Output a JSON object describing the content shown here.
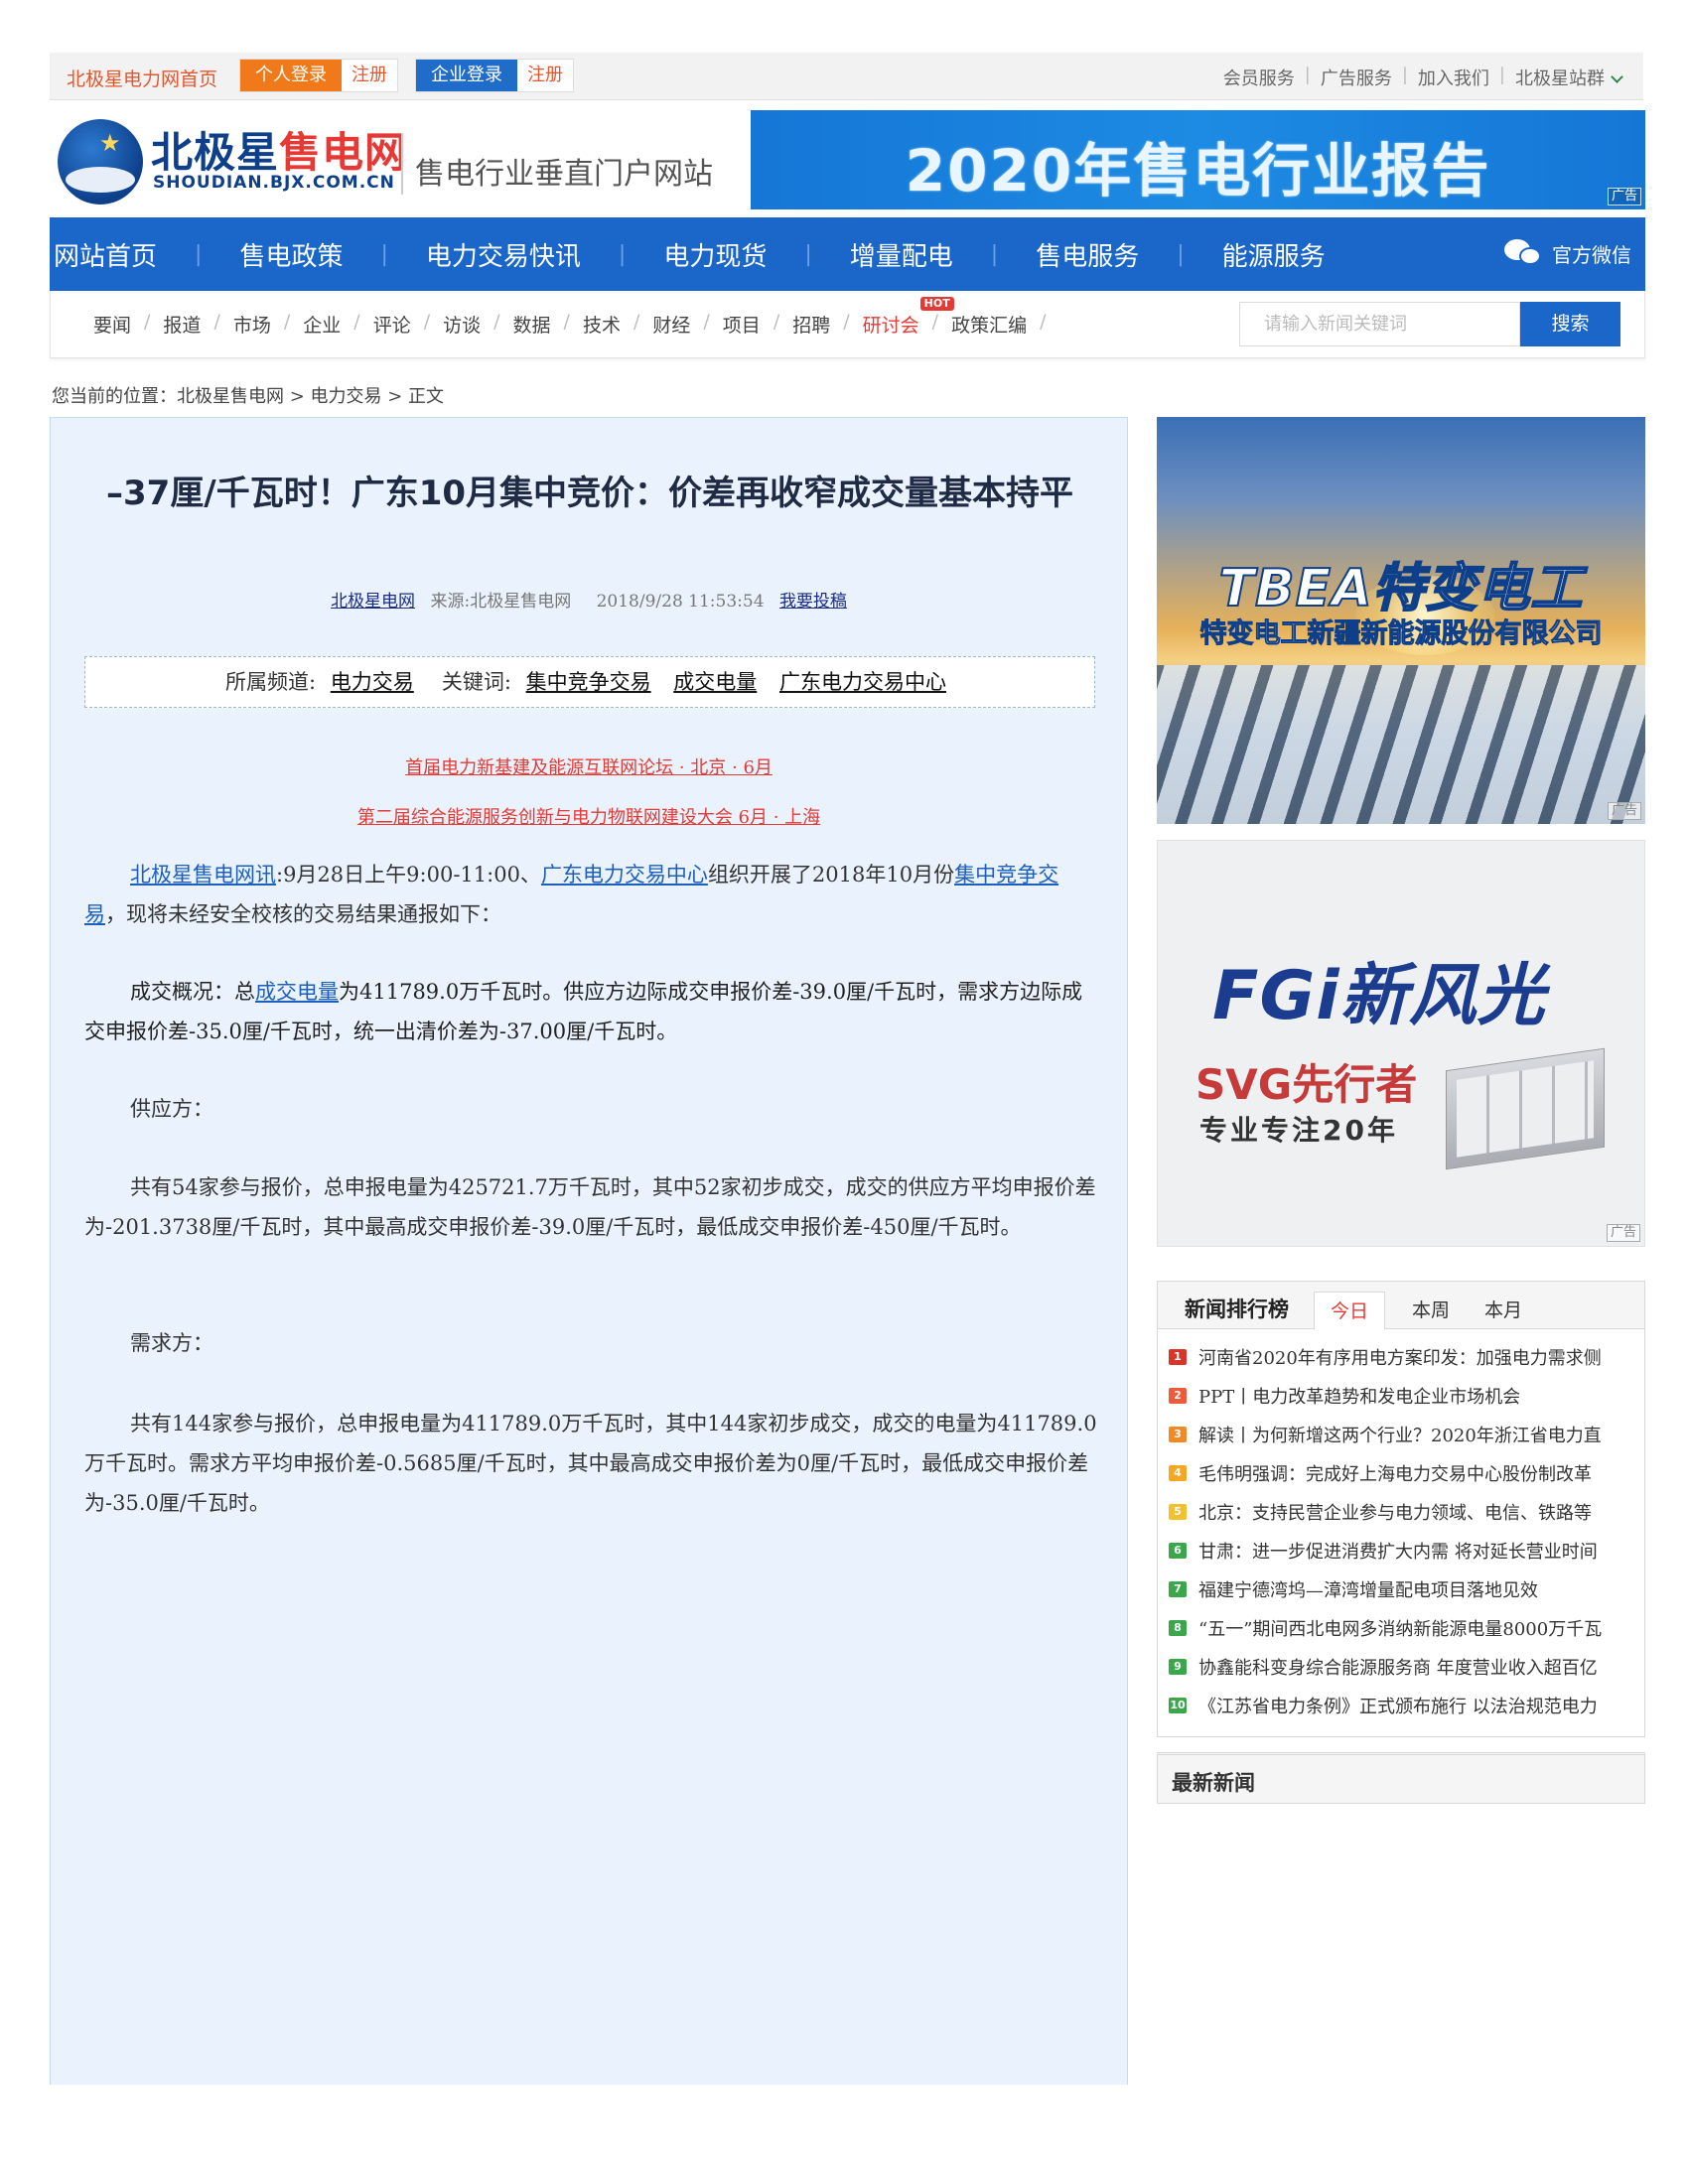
{
  "topbar": {
    "home": "北极星电力网首页",
    "personal_login": "个人登录",
    "personal_register": "注册",
    "enterprise_login": "企业登录",
    "enterprise_register": "注册",
    "links": [
      "会员服务",
      "广告服务",
      "加入我们",
      "北极星站群"
    ]
  },
  "logo": {
    "name_a": "北极星",
    "name_b": "售电网",
    "domain": "SHOUDIAN.BJX.COM.CN",
    "slogan": "售电行业垂直门户网站"
  },
  "banner_top": {
    "text": "2020年售电行业报告",
    "ad_label": "广告"
  },
  "mainnav": {
    "items": [
      "网站首页",
      "售电政策",
      "电力交易快讯",
      "电力现货",
      "增量配电",
      "售电服务",
      "能源服务"
    ],
    "wechat": "官方微信"
  },
  "subnav": {
    "items": [
      "要闻",
      "报道",
      "市场",
      "企业",
      "评论",
      "访谈",
      "数据",
      "技术",
      "财经",
      "项目",
      "招聘",
      "研讨会",
      "政策汇编"
    ],
    "hot_badge": "HOT",
    "search_placeholder": "请输入新闻关键词",
    "search_button": "搜索"
  },
  "breadcrumb": "您当前的位置：北极星售电网 > 电力交易 > 正文",
  "article": {
    "title": "–37厘/千瓦时！广东10月集中竞价：价差再收窄成交量基本持平",
    "meta_site": "北极星电网",
    "meta_source": "来源:北极星售电网",
    "meta_time": "2018/9/28 11:53:54",
    "meta_submit": "我要投稿",
    "channel_label": "所属频道:",
    "channel": "电力交易",
    "keywords_label": "关键词:",
    "keywords": [
      "集中竞争交易",
      "成交电量",
      "广东电力交易中心"
    ],
    "promo1": "首届电力新基建及能源互联网论坛 · 北京 · 6月",
    "promo2": "第二届综合能源服务创新与电力物联网建设大会 6月 · 上海",
    "p1_link1": "北极星售电网讯",
    "p1_text1": ":9月28日上午9:00-11:00、",
    "p1_link2": "广东电力交易中心",
    "p1_text2": "组织开展了2018年10月份",
    "p1_link3": "集中竞争交易",
    "p1_text3": "，现将未经安全校核的交易结果通报如下：",
    "p2_text1": "成交概况：总",
    "p2_link": "成交电量",
    "p2_text2": "为411789.0万千瓦时。供应方边际成交申报价差-39.0厘/千瓦时，需求方边际成交申报价差-35.0厘/千瓦时，统一出清价差为-37.00厘/千瓦时。",
    "p3": "供应方：",
    "p4": "共有54家参与报价，总申报电量为425721.7万千瓦时，其中52家初步成交，成交的供应方平均申报价差为-201.3738厘/千瓦时，其中最高成交申报价差-39.0厘/千瓦时，最低成交申报价差-450厘/千瓦时。",
    "p5": "需求方：",
    "p6": "共有144家参与报价，总申报电量为411789.0万千瓦时，其中144家初步成交，成交的电量为411789.0万千瓦时。需求方平均申报价差-0.5685厘/千瓦时，其中最高成交申报价差为0厘/千瓦时，最低成交申报价差为-35.0厘/千瓦时。"
  },
  "side_ad1": {
    "title": "TBEA特变电工",
    "subtitle": "特变电工新疆新能源股份有限公司",
    "ad_label": "广告"
  },
  "side_ad2": {
    "brand": "FGi新风光",
    "headline": "SVG先行者",
    "tagline": "专业专注20年",
    "ad_label": "广告"
  },
  "ranking": {
    "title": "新闻排行榜",
    "tabs": [
      "今日",
      "本周",
      "本月"
    ],
    "items": [
      "河南省2020年有序用电方案印发：加强电力需求侧",
      "PPT丨电力改革趋势和发电企业市场机会",
      "解读丨为何新增这两个行业？2020年浙江省电力直",
      "毛伟明强调：完成好上海电力交易中心股份制改革",
      "北京：支持民营企业参与电力领域、电信、铁路等",
      "甘肃：进一步促进消费扩大内需 将对延长营业时间",
      "福建宁德湾坞—漳湾增量配电项目落地见效",
      "“五一”期间西北电网多消纳新能源电量8000万千瓦",
      "协鑫能科变身综合能源服务商 年度营业收入超百亿",
      "《江苏省电力条例》正式颁布施行 以法治规范电力"
    ]
  },
  "latest": {
    "title": "最新新闻"
  }
}
